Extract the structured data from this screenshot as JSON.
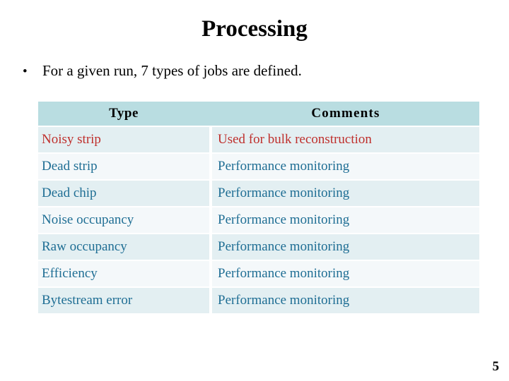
{
  "slide": {
    "title": "Processing",
    "page_number": "5",
    "bullet": {
      "marker": "•",
      "text": "For a given run, 7 types of jobs are defined."
    }
  },
  "table": {
    "columns": [
      "Type",
      "Comments"
    ],
    "rows": [
      {
        "type": "Noisy strip",
        "comment": "Used for bulk reconstruction",
        "accent": "red"
      },
      {
        "type": "Dead strip",
        "comment": "Performance monitoring",
        "accent": "blue"
      },
      {
        "type": "Dead chip",
        "comment": "Performance monitoring",
        "accent": "blue"
      },
      {
        "type": "Noise occupancy",
        "comment": "Performance monitoring",
        "accent": "blue"
      },
      {
        "type": "Raw occupancy",
        "comment": "Performance monitoring",
        "accent": "blue"
      },
      {
        "type": "Efficiency",
        "comment": "Performance monitoring",
        "accent": "blue"
      },
      {
        "type": "Bytestream error",
        "comment": "Performance monitoring",
        "accent": "blue"
      }
    ]
  },
  "colors": {
    "header_background": "#b9dde1",
    "row_shade_a": "#e3eff2",
    "row_shade_b": "#f4f8fa",
    "accent_red": "#bf2f2c",
    "accent_blue": "#1f6e94",
    "text_black": "#000000",
    "page_background": "#ffffff"
  }
}
